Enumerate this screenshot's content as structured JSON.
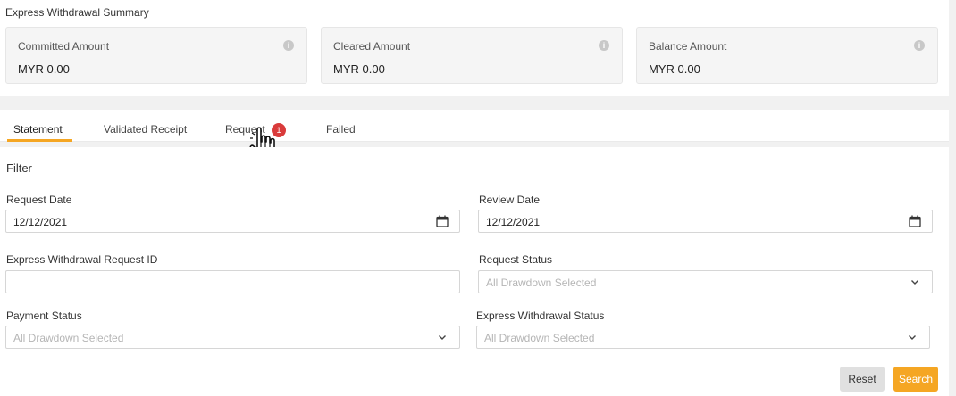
{
  "summary": {
    "title": "Express Withdrawal Summary",
    "cards": [
      {
        "label": "Committed Amount",
        "value": "MYR 0.00"
      },
      {
        "label": "Cleared Amount",
        "value": "MYR 0.00"
      },
      {
        "label": "Balance Amount",
        "value": "MYR 0.00"
      }
    ]
  },
  "tabs": [
    {
      "label": "Statement",
      "active": true
    },
    {
      "label": "Validated Receipt",
      "active": false
    },
    {
      "label": "Request",
      "active": false,
      "badge": "1"
    },
    {
      "label": "Failed",
      "active": false
    }
  ],
  "filter": {
    "title": "Filter",
    "request_date": {
      "label": "Request Date",
      "value": "12/12/2021"
    },
    "review_date": {
      "label": "Review Date",
      "value": "12/12/2021"
    },
    "request_id": {
      "label": "Express Withdrawal Request ID",
      "value": ""
    },
    "request_status": {
      "label": "Request Status",
      "placeholder": "All Drawdown Selected"
    },
    "payment_status": {
      "label": "Payment Status",
      "placeholder": "All Drawdown Selected"
    },
    "withdrawal_status": {
      "label": "Express Withdrawal Status",
      "placeholder": "All Drawdown Selected"
    }
  },
  "buttons": {
    "reset": "Reset",
    "search": "Search"
  },
  "colors": {
    "accent": "#f5a623",
    "badge": "#d93b3b"
  }
}
